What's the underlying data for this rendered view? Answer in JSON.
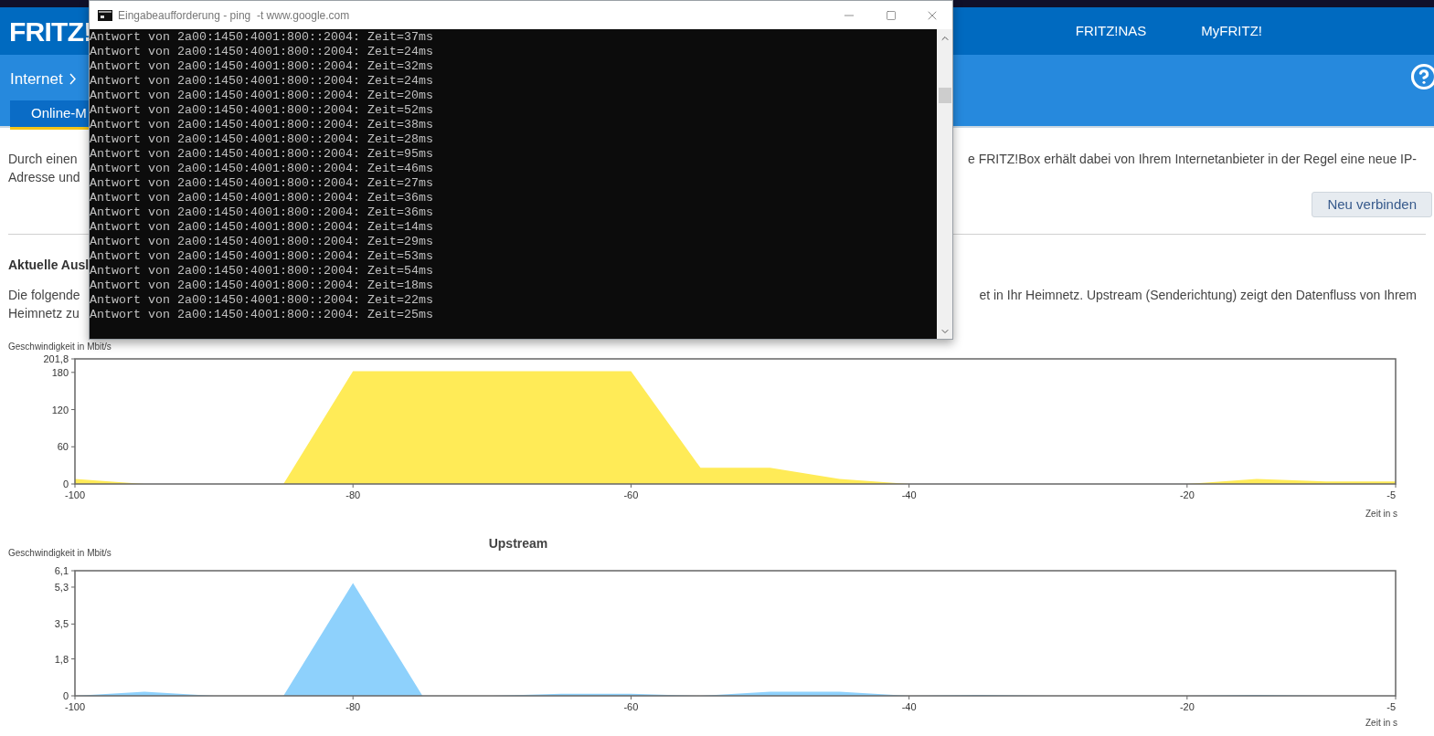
{
  "header": {
    "logo": "FRITZ!",
    "nav": [
      {
        "label": "FRITZ!NAS"
      },
      {
        "label": "MyFRITZ!"
      }
    ]
  },
  "breadcrumb": {
    "label": "Internet"
  },
  "tabs": [
    {
      "label": "Online-M",
      "selected": true
    }
  ],
  "intro": {
    "left_lines": [
      "Durch einen",
      "Adresse und"
    ],
    "right_lines": [
      "e FRITZ!Box erhält dabei von Ihrem Internetanbieter in der Regel eine neue IP-"
    ]
  },
  "button": {
    "label": "Neu verbinden"
  },
  "section": {
    "heading": "Aktuelle Ausl",
    "left_lines": [
      "Die folgende",
      "Heimnetz zu"
    ],
    "right_lines": [
      "et in Ihr Heimnetz. Upstream (Senderichtung) zeigt den Datenfluss von Ihrem"
    ]
  },
  "charts": [
    {
      "chart_data": {
        "type": "area",
        "ylabel": "Geschwindigkeit in Mbit/s",
        "xlabel": "Zeit in s",
        "x": [
          -100,
          -95,
          -90,
          -85,
          -80,
          -75,
          -70,
          -65,
          -60,
          -55,
          -50,
          -45,
          -40,
          -35,
          -30,
          -25,
          -20,
          -15,
          -10,
          -5
        ],
        "xlim": [
          -100,
          -5
        ],
        "ylim": [
          0,
          201.8
        ],
        "xticks": [
          -100,
          -80,
          -60,
          -40,
          -20,
          -5
        ],
        "yticks": [
          0,
          60,
          120,
          180,
          {
            "value": 201.8,
            "label": "201,8"
          }
        ],
        "series": [
          {
            "color": "#ffeb57",
            "values": [
              8,
              0,
              0,
              0,
              182,
              182,
              182,
              182,
              182,
              26,
              26,
              8,
              0,
              0,
              0,
              0,
              0,
              8,
              4,
              4
            ]
          }
        ]
      }
    },
    {
      "chart_data": {
        "type": "area",
        "title": "Upstream",
        "ylabel": "Geschwindigkeit in Mbit/s",
        "xlabel": "Zeit in s",
        "x": [
          -100,
          -95,
          -90,
          -85,
          -80,
          -75,
          -70,
          -65,
          -60,
          -55,
          -50,
          -45,
          -40,
          -35,
          -30,
          -25,
          -20,
          -15,
          -10,
          -5
        ],
        "xlim": [
          -100,
          -5
        ],
        "ylim": [
          0,
          6.1
        ],
        "xticks": [
          -100,
          -80,
          -60,
          -40,
          -20,
          -5
        ],
        "yticks": [
          0,
          {
            "value": 1.8,
            "label": "1,8"
          },
          {
            "value": 3.5,
            "label": "3,5"
          },
          {
            "value": 5.3,
            "label": "5,3"
          },
          {
            "value": 6.1,
            "label": "6,1"
          }
        ],
        "series": [
          {
            "color": "#8ed1fc",
            "values": [
              0,
              0.2,
              0,
              0,
              5.5,
              0,
              0,
              0.1,
              0.1,
              0,
              0.2,
              0.2,
              0,
              0.05,
              0,
              0,
              0,
              0.05,
              0,
              0
            ]
          }
        ]
      }
    }
  ],
  "console": {
    "title": "Eingabeaufforderung - ping  -t www.google.com",
    "lines": [
      "Antwort von 2a00:1450:4001:800::2004: Zeit=37ms",
      "Antwort von 2a00:1450:4001:800::2004: Zeit=24ms",
      "Antwort von 2a00:1450:4001:800::2004: Zeit=32ms",
      "Antwort von 2a00:1450:4001:800::2004: Zeit=24ms",
      "Antwort von 2a00:1450:4001:800::2004: Zeit=20ms",
      "Antwort von 2a00:1450:4001:800::2004: Zeit=52ms",
      "Antwort von 2a00:1450:4001:800::2004: Zeit=38ms",
      "Antwort von 2a00:1450:4001:800::2004: Zeit=28ms",
      "Antwort von 2a00:1450:4001:800::2004: Zeit=95ms",
      "Antwort von 2a00:1450:4001:800::2004: Zeit=46ms",
      "Antwort von 2a00:1450:4001:800::2004: Zeit=27ms",
      "Antwort von 2a00:1450:4001:800::2004: Zeit=36ms",
      "Antwort von 2a00:1450:4001:800::2004: Zeit=36ms",
      "Antwort von 2a00:1450:4001:800::2004: Zeit=14ms",
      "Antwort von 2a00:1450:4001:800::2004: Zeit=29ms",
      "Antwort von 2a00:1450:4001:800::2004: Zeit=53ms",
      "Antwort von 2a00:1450:4001:800::2004: Zeit=54ms",
      "Antwort von 2a00:1450:4001:800::2004: Zeit=18ms",
      "Antwort von 2a00:1450:4001:800::2004: Zeit=22ms",
      "Antwort von 2a00:1450:4001:800::2004: Zeit=25ms"
    ]
  }
}
